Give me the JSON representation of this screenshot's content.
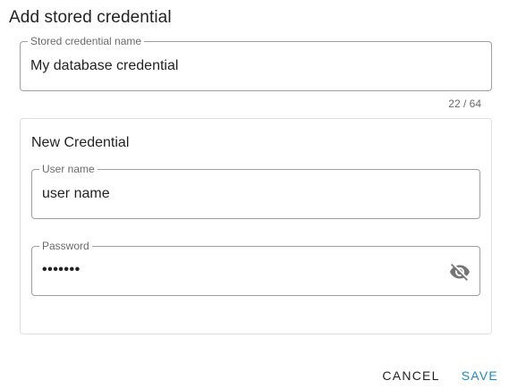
{
  "dialog": {
    "title": "Add stored credential"
  },
  "credential_name": {
    "label": "Stored credential name",
    "value": "My database credential",
    "counter": "22 / 64"
  },
  "new_credential": {
    "title": "New Credential",
    "username": {
      "label": "User name",
      "value": "user name"
    },
    "password": {
      "label": "Password",
      "value": "•••••••",
      "toggle_icon": "visibility-off-icon"
    }
  },
  "actions": {
    "cancel_label": "CANCEL",
    "save_label": "SAVE"
  },
  "colors": {
    "accent": "#1e88c7",
    "border": "#9e9e9e",
    "label": "#757575"
  }
}
